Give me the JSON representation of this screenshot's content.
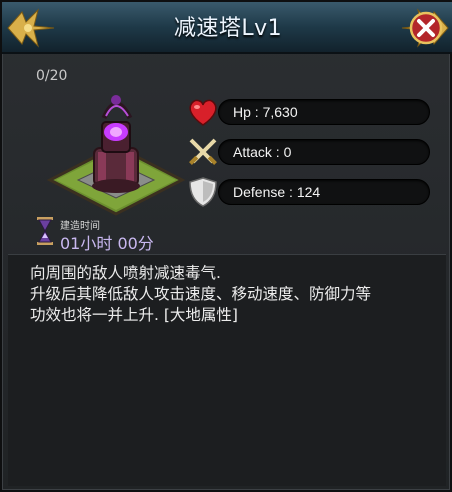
{
  "window": {
    "title": "减速塔Lv1",
    "close_icon": "close-x-icon",
    "ornament_icon": "gold-ornament-icon"
  },
  "level_count": "0/20",
  "tower_image": "slow-tower-icon",
  "stats": [
    {
      "icon": "heart-icon",
      "text": "Hp : 7,630"
    },
    {
      "icon": "crossed-swords-icon",
      "text": "Attack : 0"
    },
    {
      "icon": "shield-icon",
      "text": "Defense : 124"
    }
  ],
  "build_time": {
    "icon": "hourglass-icon",
    "caption": "建造时间",
    "value": "01小时 00分"
  },
  "description": [
    "向周围的敌人喷射减速毒气.",
    "升级后其降低敌人攻击速度、移动速度、防御力等",
    "功效也将一并上升. [大地属性]"
  ],
  "colors": {
    "title_bar": "#1e3948",
    "close_button": "#b3262a",
    "ornament": "#d9b04a",
    "accent_text": "#c9b8f0"
  }
}
